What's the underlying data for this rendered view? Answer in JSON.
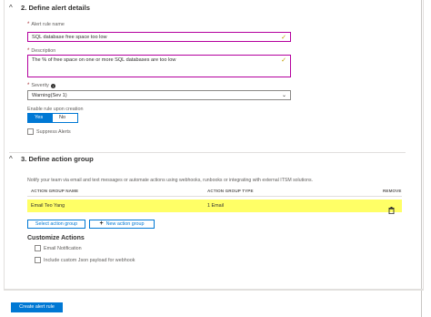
{
  "section2": {
    "title": "2. Define alert details",
    "chevron": "^",
    "alert_rule_name": {
      "label": "Alert rule name",
      "value": "SQL database free space too low"
    },
    "description": {
      "label": "Description",
      "value": "The % of free space on one or more SQL databases are too low"
    },
    "severity": {
      "label": "Severity",
      "value": "Warning(Sev 1)"
    },
    "enable_rule": {
      "label": "Enable rule upon creation",
      "yes": "Yes",
      "no": "No",
      "selected": "Yes"
    },
    "suppress_alerts": {
      "label": "Suppress Alerts",
      "checked": false
    }
  },
  "section3": {
    "title": "3. Define action group",
    "chevron": "^",
    "description": "Notify your team via email and text messages or automate actions using webhooks, runbooks or integrating with external ITSM solutions.",
    "table": {
      "headers": {
        "name": "ACTION GROUP NAME",
        "type": "ACTION GROUP TYPE",
        "remove": "REMOVE"
      },
      "rows": [
        {
          "name": "Email Teo Yang",
          "type": "1 Email",
          "remove_icon": "trash-icon"
        }
      ]
    },
    "select_button": "Select action group",
    "new_button": "New action group",
    "customize": {
      "title": "Customize Actions",
      "email_notification": {
        "label": "Email Notification",
        "checked": false
      },
      "custom_json": {
        "label": "Include custom Json payload for webhook",
        "checked": false
      }
    }
  },
  "footer": {
    "create_button": "Create alert rule"
  },
  "colors": {
    "accent": "#0078d4",
    "highlight": "#ffff66",
    "focus_border": "#b4009e"
  },
  "icons": {
    "required": "required-asterisk",
    "info": "info-icon",
    "valid": "checkmark-icon",
    "dropdown": "chevron-down-icon",
    "add": "plus-icon"
  }
}
